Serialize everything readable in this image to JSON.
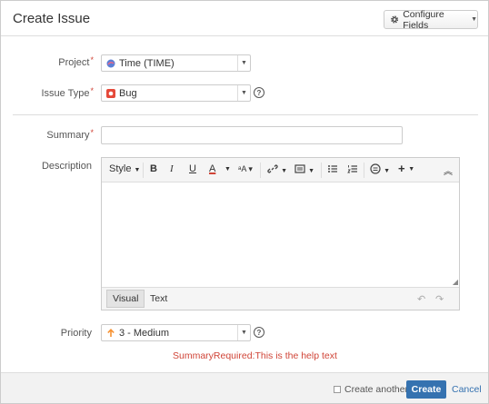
{
  "dialog": {
    "title": "Create Issue",
    "configure_fields_label": "Configure Fields"
  },
  "project": {
    "label": "Project",
    "value": "Time (TIME)"
  },
  "issue_type": {
    "label": "Issue Type",
    "value": "Bug"
  },
  "summary": {
    "label": "Summary",
    "value": ""
  },
  "description": {
    "label": "Description",
    "toolbar": {
      "style_label": "Style",
      "bold": "B",
      "italic": "I",
      "underline": "U",
      "text_color": "A"
    },
    "modes": {
      "visual_label": "Visual",
      "text_label": "Text"
    }
  },
  "priority": {
    "label": "Priority",
    "value": "3 - Medium"
  },
  "help_text": "SummaryRequired:This is the help text",
  "footer": {
    "create_another_label": "Create another",
    "create_label": "Create",
    "cancel_label": "Cancel"
  },
  "colors": {
    "accent": "#3572b0",
    "error": "#d04437",
    "bug_icon": "#e5493a",
    "priority_icon": "#f79232"
  }
}
